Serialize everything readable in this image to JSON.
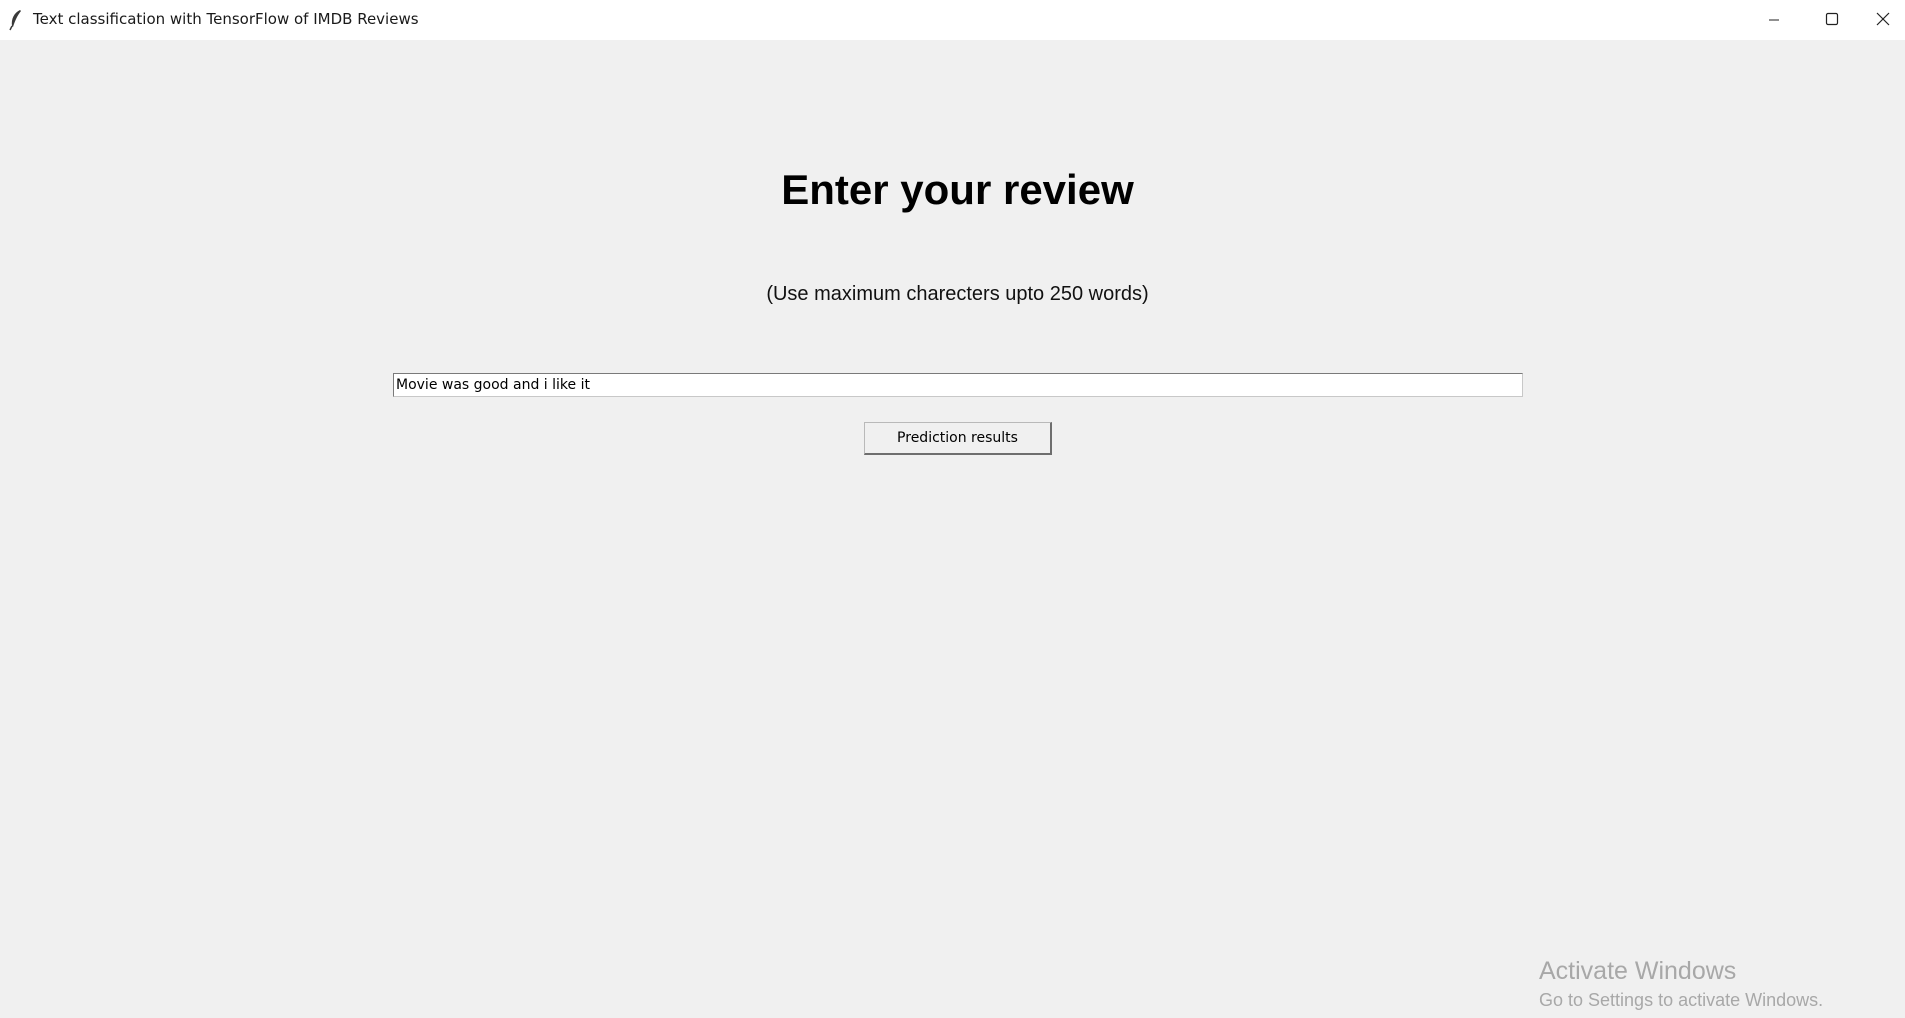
{
  "window": {
    "title": "Text classification with TensorFlow of IMDB Reviews",
    "app_icon": "feather-icon",
    "controls": {
      "minimize_icon": "minimize-icon",
      "maximize_icon": "maximize-icon",
      "close_icon": "close-icon"
    }
  },
  "main": {
    "heading": "Enter your review",
    "hint": "(Use maximum charecters upto 250 words)",
    "review_input": {
      "value": "Movie was good and i like it"
    },
    "predict_button_label": "Prediction results"
  },
  "watermark": {
    "title": "Activate Windows",
    "subtitle": "Go to Settings to activate Windows."
  },
  "colors": {
    "background": "#f0f0f0",
    "titlebar": "#ffffff",
    "watermark_text": "#a8a8a8"
  }
}
